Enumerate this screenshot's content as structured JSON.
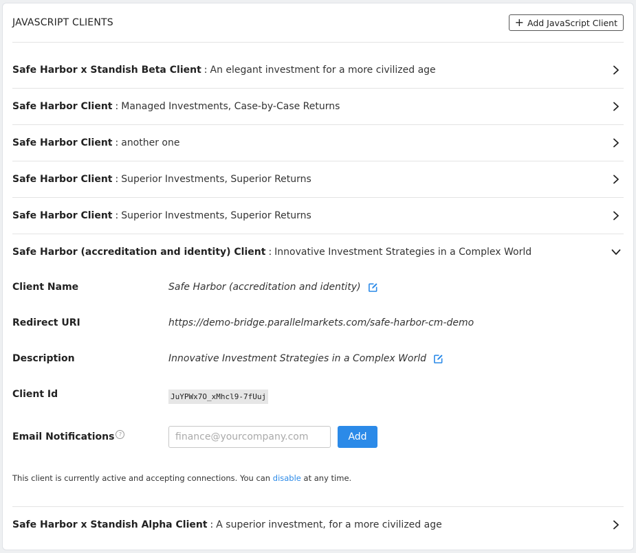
{
  "header": {
    "title": "JAVASCRIPT CLIENTS",
    "add_button_label": "Add JavaScript Client"
  },
  "clients": [
    {
      "name": "Safe Harbor x Standish Beta Client",
      "description": "An elegant investment for a more civilized age"
    },
    {
      "name": "Safe Harbor Client",
      "description": "Managed Investments, Case-by-Case Returns"
    },
    {
      "name": "Safe Harbor Client",
      "description": "another one"
    },
    {
      "name": "Safe Harbor Client",
      "description": "Superior Investments, Superior Returns"
    },
    {
      "name": "Safe Harbor Client",
      "description": "Superior Investments, Superior Returns"
    },
    {
      "name": "Safe Harbor (accreditation and identity) Client",
      "description": "Innovative Investment Strategies in a Complex World"
    },
    {
      "name": "Safe Harbor x Standish Alpha Client",
      "description": "A superior investment, for a more civilized age"
    }
  ],
  "separator": ":",
  "expanded": {
    "client_name_label": "Client Name",
    "client_name_value": "Safe Harbor (accreditation and identity)",
    "redirect_uri_label": "Redirect URI",
    "redirect_uri_value": "https://demo-bridge.parallelmarkets.com/safe-harbor-cm-demo",
    "description_label": "Description",
    "description_value": "Innovative Investment Strategies in a Complex World",
    "client_id_label": "Client Id",
    "client_id_value": "JuYPWx7O_xMhcl9-7fUuj",
    "email_label": "Email Notifications",
    "help_glyph": "?",
    "email_placeholder": "finance@yourcompany.com",
    "email_add_label": "Add",
    "status_prefix": "This client is currently active and accepting connections. You can",
    "status_link": "disable",
    "status_suffix": "at any time."
  },
  "colors": {
    "accent": "#2b8ae8",
    "border": "#e3e3e3",
    "code_bg": "#e6e6e6"
  },
  "icons": {
    "collapsed": "chevron-right-icon",
    "expanded": "chevron-down-icon",
    "edit": "edit-icon",
    "help": "help-icon",
    "add": "plus-icon"
  }
}
